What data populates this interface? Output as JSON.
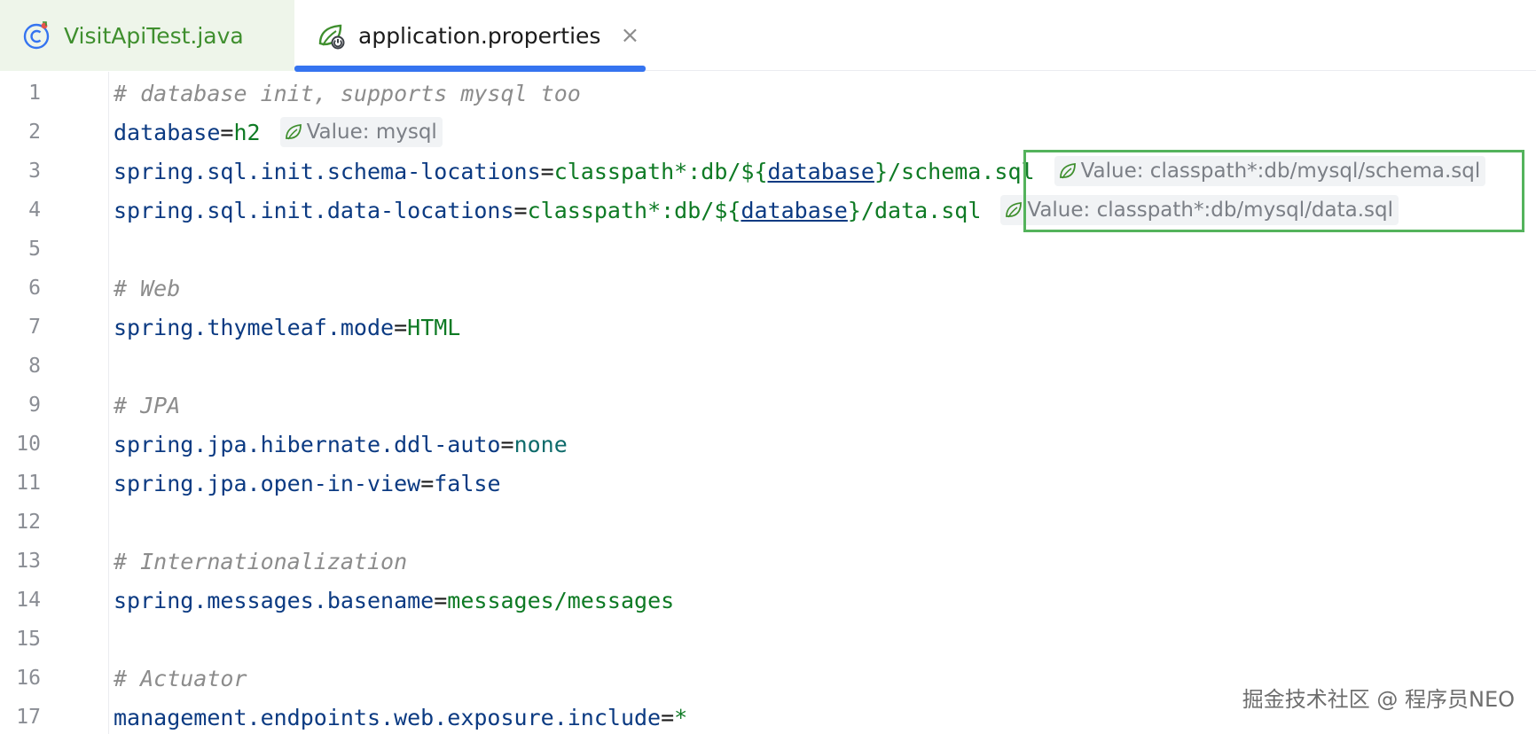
{
  "tabs": [
    {
      "label": "VisitApiTest.java",
      "icon": "java-class-icon",
      "active": false
    },
    {
      "label": "application.properties",
      "icon": "spring-properties-icon",
      "active": true,
      "close_glyph": "×"
    }
  ],
  "colors": {
    "active_tab_indicator": "#3574f0",
    "highlight_box": "#54b35c",
    "comment": "#8c8c8c",
    "key": "#0b3a82",
    "value": "#0e7a24"
  },
  "lines": [
    {
      "n": "1",
      "comment": "# database init, supports mysql too"
    },
    {
      "n": "2",
      "key": "database",
      "eq": "=",
      "value": "h2",
      "hint": "Value: mysql"
    },
    {
      "n": "3",
      "key": "spring.sql.init.schema-locations",
      "eq": "=",
      "value_a": "classpath*:db/${",
      "value_ul": "database",
      "value_b": "}/schema.sql",
      "hint": "Value: classpath*:db/mysql/schema.sql"
    },
    {
      "n": "4",
      "key": "spring.sql.init.data-locations",
      "eq": "=",
      "value_a": "classpath*:db/${",
      "value_ul": "database",
      "value_b": "}/data.sql",
      "hint": "Value: classpath*:db/mysql/data.sql"
    },
    {
      "n": "5"
    },
    {
      "n": "6",
      "comment": "# Web"
    },
    {
      "n": "7",
      "key": "spring.thymeleaf.mode",
      "eq": "=",
      "value": "HTML"
    },
    {
      "n": "8"
    },
    {
      "n": "9",
      "comment": "# JPA"
    },
    {
      "n": "10",
      "key": "spring.jpa.hibernate.ddl-auto",
      "eq": "=",
      "value": "none"
    },
    {
      "n": "11",
      "key": "spring.jpa.open-in-view",
      "eq": "=",
      "value": "false"
    },
    {
      "n": "12"
    },
    {
      "n": "13",
      "comment": "# Internationalization"
    },
    {
      "n": "14",
      "key": "spring.messages.basename",
      "eq": "=",
      "value": "messages/messages"
    },
    {
      "n": "15"
    },
    {
      "n": "16",
      "comment": "# Actuator"
    },
    {
      "n": "17",
      "key": "management.endpoints.web.exposure.include",
      "eq": "=",
      "value": "*"
    }
  ],
  "watermark": "掘金技术社区 @ 程序员NEO"
}
